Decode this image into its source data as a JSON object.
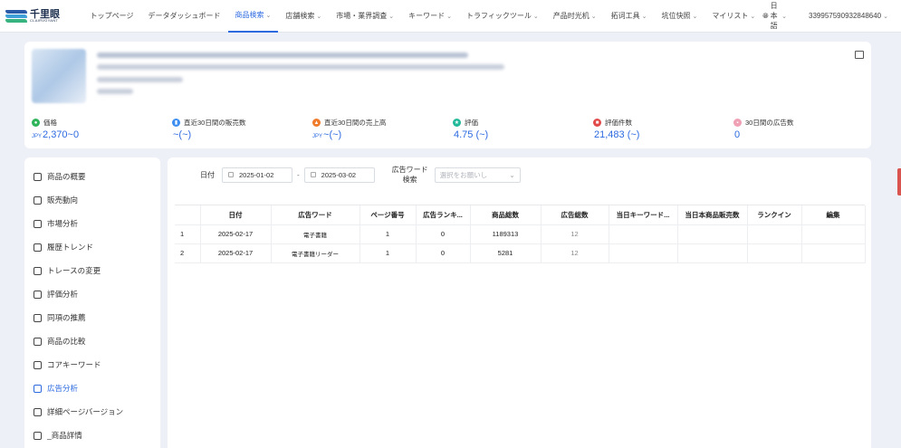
{
  "brand": {
    "name": "千里眼",
    "sub": "CLAIRVOYANT"
  },
  "nav": {
    "items": [
      {
        "label": "トップページ",
        "chevron": false,
        "active": false
      },
      {
        "label": "データダッシュボード",
        "chevron": false,
        "active": false
      },
      {
        "label": "商品検索",
        "chevron": true,
        "active": true
      },
      {
        "label": "店舗検索",
        "chevron": true,
        "active": false
      },
      {
        "label": "市場・業界調査",
        "chevron": true,
        "active": false
      },
      {
        "label": "キーワード",
        "chevron": true,
        "active": false
      },
      {
        "label": "トラフィックツール",
        "chevron": true,
        "active": false
      },
      {
        "label": "产品时光机",
        "chevron": true,
        "active": false
      },
      {
        "label": "拓词工具",
        "chevron": true,
        "active": false
      },
      {
        "label": "坑位快照",
        "chevron": true,
        "active": false
      },
      {
        "label": "マイリスト",
        "chevron": true,
        "active": false
      }
    ],
    "language": "日本語",
    "user_id": "339957590932848640"
  },
  "product": {
    "stats": [
      {
        "label": "価格",
        "currency": "JPY",
        "value": "2,370~0",
        "icon": "tag-icon",
        "color": "#2fb45a"
      },
      {
        "label": "直近30日間の販売数",
        "currency": "",
        "value": "~(~)",
        "icon": "bar-chart-icon",
        "color": "#3d8ef0"
      },
      {
        "label": "直近30日間の売上高",
        "currency": "JPY",
        "value": "~(~)",
        "icon": "flame-icon",
        "color": "#f07b2a"
      },
      {
        "label": "評価",
        "currency": "",
        "value": "4.75 (~)",
        "icon": "star-icon",
        "color": "#22b89a"
      },
      {
        "label": "評価件数",
        "currency": "",
        "value": "21,483 (~)",
        "icon": "comment-icon",
        "color": "#e24a4a"
      },
      {
        "label": "30日間の広告数",
        "currency": "",
        "value": "0",
        "icon": "ad-icon",
        "color": "#f0a0b5"
      }
    ]
  },
  "sidebar": {
    "items": [
      {
        "label": "商品の概要",
        "icon": "overview-icon",
        "active": false
      },
      {
        "label": "販売動向",
        "icon": "pie-chart-icon",
        "active": false
      },
      {
        "label": "市場分析",
        "icon": "market-icon",
        "active": false
      },
      {
        "label": "履歴トレンド",
        "icon": "history-icon",
        "active": false
      },
      {
        "label": "トレースの変更",
        "icon": "trace-icon",
        "active": false
      },
      {
        "label": "評価分析",
        "icon": "review-icon",
        "active": false
      },
      {
        "label": "同項の推薦",
        "icon": "recommend-icon",
        "active": false
      },
      {
        "label": "商品の比較",
        "icon": "compare-icon",
        "active": false
      },
      {
        "label": "コアキーワード",
        "icon": "keyword-icon",
        "active": false
      },
      {
        "label": "広告分析",
        "icon": "ad-analysis-icon",
        "active": true
      },
      {
        "label": "詳細ページバージョン",
        "icon": "version-icon",
        "active": false
      },
      {
        "label": "_商品詳情",
        "icon": "detail-icon",
        "active": false
      }
    ]
  },
  "filters": {
    "date_label": "日付",
    "date_start": "2025-01-02",
    "date_end": "2025-03-02",
    "date_separator": "-",
    "keyword_label": "広告ワード検索",
    "keyword_placeholder": "選択をお願いし"
  },
  "table": {
    "columns": [
      "",
      "日付",
      "広告ワード",
      "ページ番号",
      "広告ランキ...",
      "商品総数",
      "広告総数",
      "当日キーワード...",
      "当日本商品販売数",
      "ランクイン",
      "編集"
    ],
    "rows": [
      [
        "1",
        "2025-02-17",
        "電子書籍",
        "1",
        "0",
        "1189313",
        "12",
        "",
        "",
        "",
        ""
      ],
      [
        "2",
        "2025-02-17",
        "電子書籍リーダー",
        "1",
        "0",
        "5281",
        "12",
        "",
        "",
        "",
        ""
      ]
    ]
  }
}
